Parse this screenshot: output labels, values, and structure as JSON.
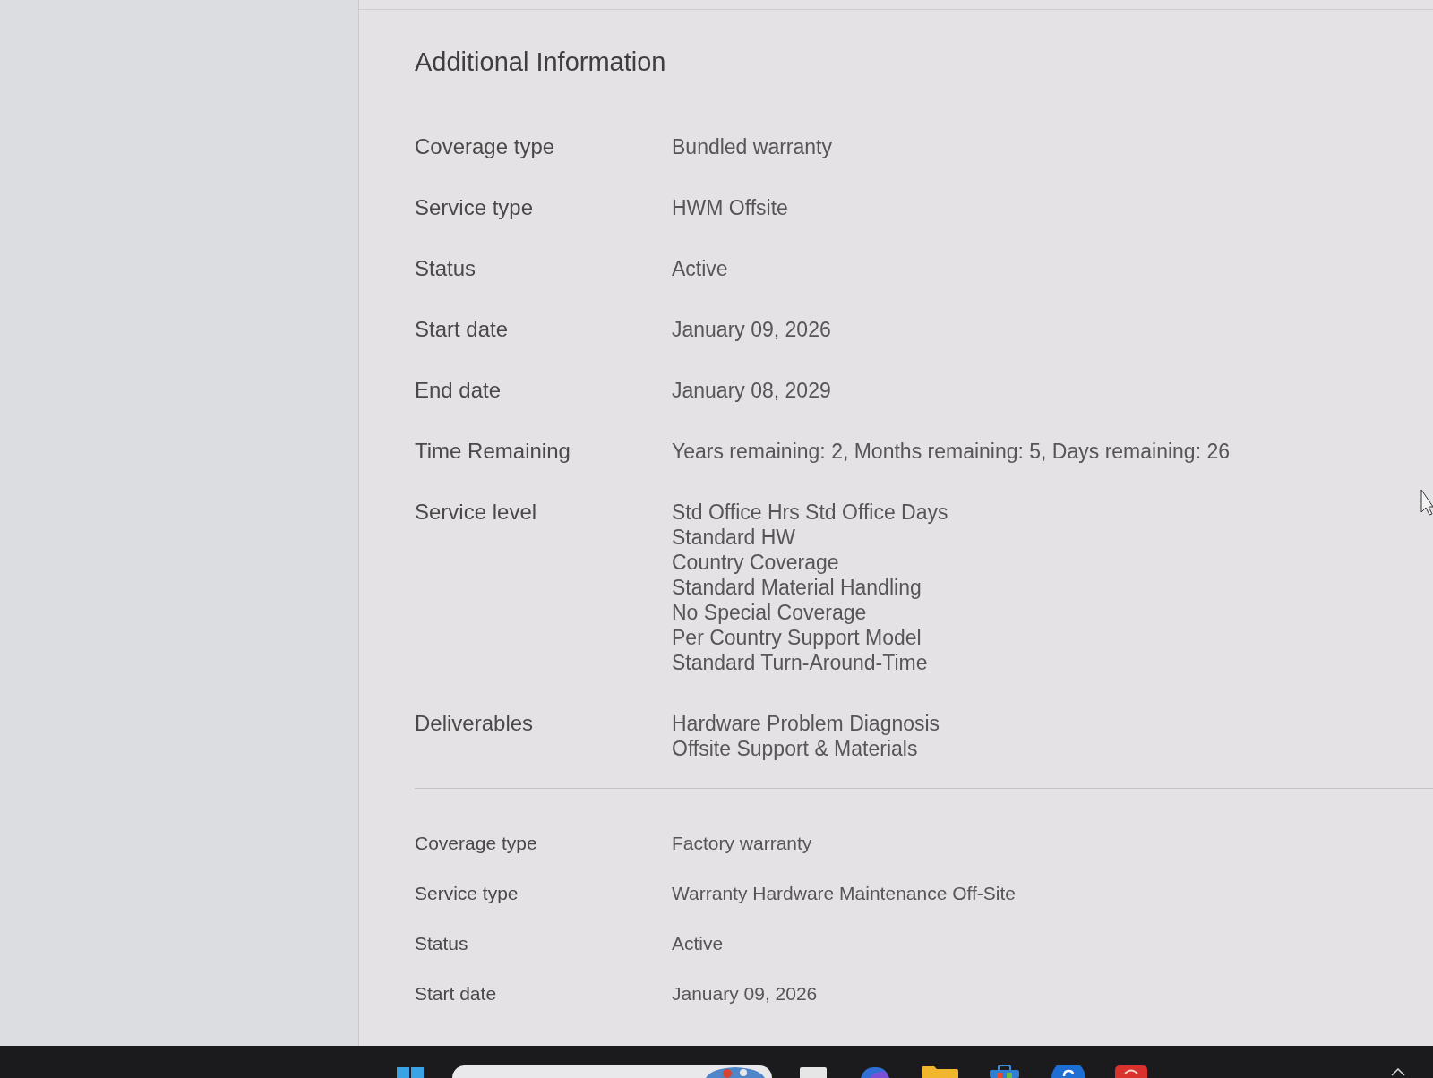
{
  "section_title": "Additional Information",
  "coverages": [
    {
      "rows": [
        {
          "label": "Coverage type",
          "lines": [
            "Bundled warranty"
          ]
        },
        {
          "label": "Service type",
          "lines": [
            "HWM Offsite"
          ]
        },
        {
          "label": "Status",
          "lines": [
            "Active"
          ]
        },
        {
          "label": "Start date",
          "lines": [
            "January 09, 2026"
          ]
        },
        {
          "label": "End date",
          "lines": [
            "January 08, 2029"
          ]
        },
        {
          "label": "Time Remaining",
          "lines": [
            "Years remaining: 2, Months remaining: 5, Days remaining: 26"
          ]
        },
        {
          "label": "Service level",
          "lines": [
            "Std Office Hrs Std Office Days",
            "Standard HW",
            "Country Coverage",
            "Standard Material Handling",
            "No Special Coverage",
            "Per Country Support Model",
            "Standard Turn-Around-Time"
          ]
        },
        {
          "label": "Deliverables",
          "lines": [
            "Hardware Problem Diagnosis",
            "Offsite Support & Materials"
          ]
        }
      ]
    },
    {
      "rows": [
        {
          "label": "Coverage type",
          "lines": [
            "Factory warranty"
          ]
        },
        {
          "label": "Service type",
          "lines": [
            "Warranty Hardware Maintenance Off-Site"
          ]
        },
        {
          "label": "Status",
          "lines": [
            "Active"
          ]
        },
        {
          "label": "Start date",
          "lines": [
            "January 09, 2026"
          ]
        }
      ]
    }
  ]
}
